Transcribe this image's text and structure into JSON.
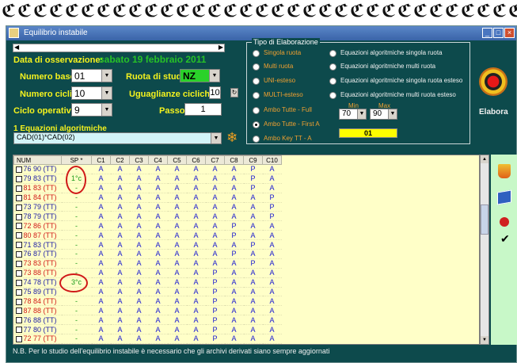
{
  "window": {
    "title": "Equilibrio instabile"
  },
  "form": {
    "date_label": "Data di osservazione:",
    "date_value": "sabato 19 febbraio 2011",
    "numero_base_label": "Numero base:",
    "numero_base_value": "01",
    "ruota_label": "Ruota di studio:",
    "ruota_value": "NZ",
    "numero_cicli_label": "Numero cicli:",
    "numero_cicli_value": "10",
    "uguaglianze_label": "Uguaglianze cicliche:",
    "uguaglianze_value": "10",
    "ciclo_label": "Ciclo operativo:",
    "ciclo_value": "9",
    "passo_label": "Passo:",
    "passo_value": "1",
    "equazioni_label": "1 Equazioni algoritmiche",
    "equazioni_value": "CAD(01)*CAD(02)"
  },
  "tipo": {
    "title": "Tipo di Elaborazione",
    "left_options": [
      "Singola ruota",
      "Multi ruota",
      "UNI-esteso",
      "MULTI-esteso",
      "Ambo Tutte - Full",
      "Ambo Tutte - First A",
      "Ambo Key TT -  A"
    ],
    "right_options": [
      "Equazioni algoritmiche singola ruota",
      "Equazioni algoritmiche multi ruota",
      "Equazioni algoritmiche singola ruota esteso",
      "Equazioni algoritmiche multi ruota esteso"
    ],
    "min_label": "Min",
    "max_label": "Max",
    "min_value": "70",
    "max_value": "90",
    "key_value": "01",
    "elabora_label": "Elabora"
  },
  "grid": {
    "headers": [
      "NUM",
      "SP *",
      "C1",
      "C2",
      "C3",
      "C4",
      "C5",
      "C6",
      "C7",
      "C8",
      "C9",
      "C10"
    ],
    "rows": [
      {
        "num": "76 90  (TT)",
        "red": false,
        "sp": "-",
        "cells": [
          "A",
          "A",
          "A",
          "A",
          "A",
          "A",
          "A",
          "A",
          "P",
          "A"
        ]
      },
      {
        "num": "79 83  (TT)",
        "red": false,
        "sp": "1°c",
        "cells": [
          "A",
          "A",
          "A",
          "A",
          "A",
          "A",
          "A",
          "A",
          "P",
          "A"
        ]
      },
      {
        "num": "81 83  (TT)",
        "red": true,
        "sp": "-",
        "cells": [
          "A",
          "A",
          "A",
          "A",
          "A",
          "A",
          "A",
          "A",
          "P",
          "A"
        ]
      },
      {
        "num": "81 84  (TT)",
        "red": true,
        "sp": "-",
        "cells": [
          "A",
          "A",
          "A",
          "A",
          "A",
          "A",
          "A",
          "A",
          "A",
          "P"
        ]
      },
      {
        "num": "73 79  (TT)",
        "red": false,
        "sp": "-",
        "cells": [
          "A",
          "A",
          "A",
          "A",
          "A",
          "A",
          "A",
          "A",
          "A",
          "P"
        ]
      },
      {
        "num": "78 79  (TT)",
        "red": false,
        "sp": "-",
        "cells": [
          "A",
          "A",
          "A",
          "A",
          "A",
          "A",
          "A",
          "A",
          "A",
          "P"
        ]
      },
      {
        "num": "72 86  (TT)",
        "red": true,
        "sp": "-",
        "cells": [
          "A",
          "A",
          "A",
          "A",
          "A",
          "A",
          "A",
          "P",
          "A",
          "A"
        ]
      },
      {
        "num": "80 87  (TT)",
        "red": true,
        "sp": "-",
        "cells": [
          "A",
          "A",
          "A",
          "A",
          "A",
          "A",
          "A",
          "P",
          "A",
          "A"
        ]
      },
      {
        "num": "71 83  (TT)",
        "red": false,
        "sp": "-",
        "cells": [
          "A",
          "A",
          "A",
          "A",
          "A",
          "A",
          "A",
          "A",
          "P",
          "A"
        ]
      },
      {
        "num": "76 87  (TT)",
        "red": false,
        "sp": "-",
        "cells": [
          "A",
          "A",
          "A",
          "A",
          "A",
          "A",
          "A",
          "P",
          "A",
          "A"
        ]
      },
      {
        "num": "73 83  (TT)",
        "red": true,
        "sp": "-",
        "cells": [
          "A",
          "A",
          "A",
          "A",
          "A",
          "A",
          "A",
          "A",
          "P",
          "A"
        ]
      },
      {
        "num": "73 88  (TT)",
        "red": true,
        "sp": "-",
        "cells": [
          "A",
          "A",
          "A",
          "A",
          "A",
          "A",
          "P",
          "A",
          "A",
          "A"
        ]
      },
      {
        "num": "74 78  (TT)",
        "red": false,
        "sp": "3°c",
        "cells": [
          "A",
          "A",
          "A",
          "A",
          "A",
          "A",
          "P",
          "A",
          "A",
          "A"
        ]
      },
      {
        "num": "75 89  (TT)",
        "red": false,
        "sp": "-",
        "cells": [
          "A",
          "A",
          "A",
          "A",
          "A",
          "A",
          "P",
          "A",
          "A",
          "A"
        ]
      },
      {
        "num": "78 84  (TT)",
        "red": true,
        "sp": "-",
        "cells": [
          "A",
          "A",
          "A",
          "A",
          "A",
          "A",
          "P",
          "A",
          "A",
          "A"
        ]
      },
      {
        "num": "87 88  (TT)",
        "red": true,
        "sp": "-",
        "cells": [
          "A",
          "A",
          "A",
          "A",
          "A",
          "A",
          "P",
          "A",
          "A",
          "A"
        ]
      },
      {
        "num": "76 88  (TT)",
        "red": false,
        "sp": "-",
        "cells": [
          "A",
          "A",
          "A",
          "A",
          "A",
          "A",
          "P",
          "A",
          "A",
          "A"
        ]
      },
      {
        "num": "77 80  (TT)",
        "red": false,
        "sp": "-",
        "cells": [
          "A",
          "A",
          "A",
          "A",
          "A",
          "A",
          "P",
          "A",
          "A",
          "A"
        ]
      },
      {
        "num": "72 77  (TT)",
        "red": true,
        "sp": "-",
        "cells": [
          "A",
          "A",
          "A",
          "A",
          "A",
          "A",
          "P",
          "A",
          "A",
          "A"
        ]
      }
    ]
  },
  "footer": {
    "note": "N.B. Per lo studio dell'equilibrio instabile è necessario che gli archivi derivati siano sempre aggiornati"
  }
}
